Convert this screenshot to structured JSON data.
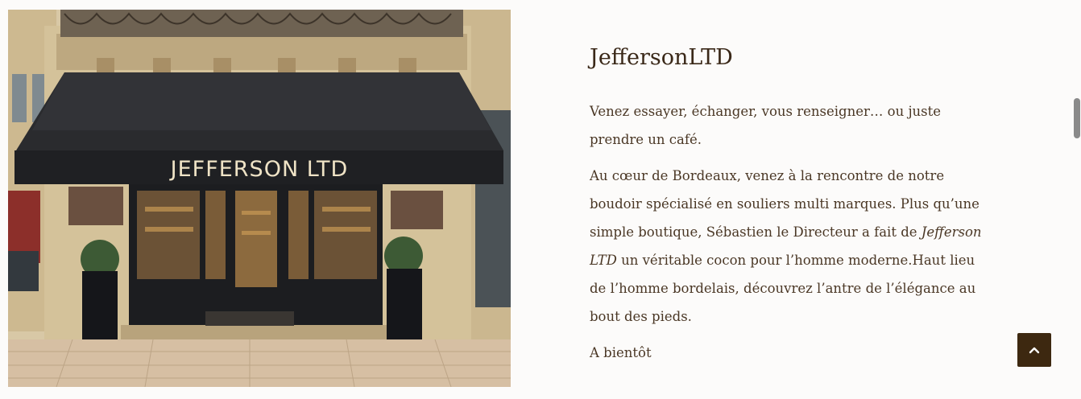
{
  "storefront_image": {
    "sign_text": "JEFFERSON LTD"
  },
  "article": {
    "title": "JeffersonLTD",
    "paragraph1": "Venez essayer, échanger, vous renseigner… ou juste prendre un café.",
    "paragraph2_before": "Au cœur de Bordeaux, venez à la rencontre de notre boudoir spécialisé en souliers multi marques. Plus qu’une simple boutique, Sébastien le Directeur a fait de ",
    "paragraph2_emphasis": "Jefferson LTD",
    "paragraph2_after": " un véritable cocon pour l’homme moderne.Haut lieu de l’homme bordelais, découvrez l’antre de l’élégance au bout des pieds.",
    "signoff": "A bientôt"
  },
  "back_to_top": {
    "icon": "chevron-up-icon",
    "color": "#3d2810"
  }
}
